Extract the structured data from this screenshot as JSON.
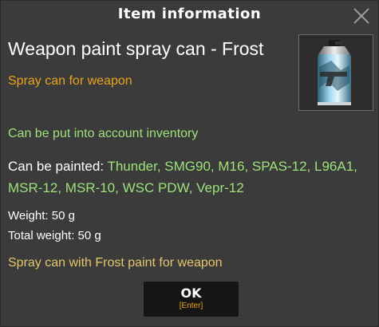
{
  "dialog": {
    "title": "Item information",
    "close_icon": "close-icon"
  },
  "item": {
    "name": "Weapon paint spray can - Frost",
    "subtitle": "Spray can for weapon",
    "icon": "spray-can-icon",
    "inventory_note": "Can be put into account inventory",
    "paintable_label": "Can be painted: ",
    "paintable_list": "Thunder, SMG90, M16, SPAS-12, L96A1, MSR-12, MSR-10, WSC PDW, Vepr-12",
    "weight_label": "Weight: ",
    "weight_value": "50 g",
    "total_weight_label": "Total weight: ",
    "total_weight_value": "50 g",
    "description": "Spray can with Frost paint for weapon"
  },
  "ok_button": {
    "label": "OK",
    "hint": "[Enter]"
  },
  "colors": {
    "subtitle": "#e8a418",
    "green_text": "#9ee27a",
    "description": "#e6c66a",
    "background": "#3b3b3b"
  }
}
